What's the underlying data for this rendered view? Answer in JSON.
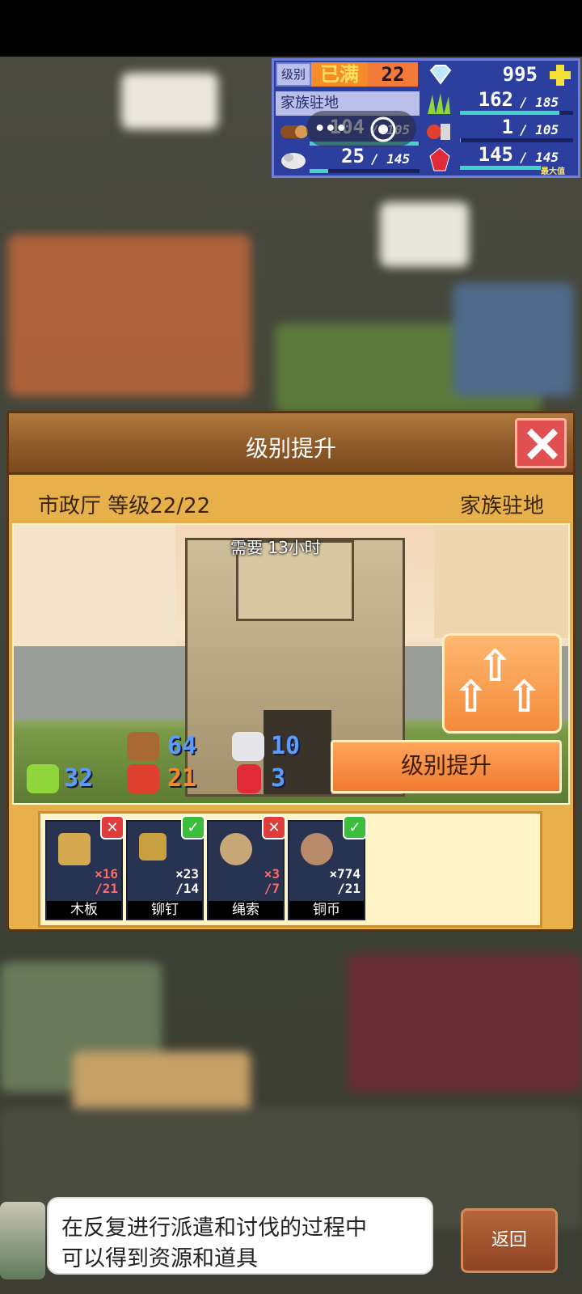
{
  "hud": {
    "level_label": "级别",
    "level_status": "已满",
    "level_value": "22",
    "gems": "995",
    "plus_icon": "plus-icon",
    "clan_name": "家族驻地",
    "wood": {
      "current": "104",
      "max": "105",
      "fill": 0.99
    },
    "ore": {
      "current": "25",
      "max": "145",
      "fill": 0.17
    },
    "grass": {
      "current": "162",
      "max": "185",
      "fill": 0.88
    },
    "food": {
      "current": "1",
      "max": "105",
      "fill": 0.01
    },
    "ruby": {
      "current": "145",
      "max": "145",
      "max_label": "最大值",
      "fill": 1.0
    }
  },
  "panel": {
    "title": "级别提升",
    "building": "市政厅 等级22/22",
    "location": "家族驻地",
    "need_time": "需要 13小时",
    "upgrade_button": "级别提升",
    "costs": {
      "wood": "64",
      "ore": "10",
      "grass": "32",
      "food": "21",
      "ruby": "3"
    },
    "items": [
      {
        "name": "木板",
        "have": "×16",
        "need": "/21",
        "ok": false,
        "badge": "✕"
      },
      {
        "name": "铆钉",
        "have": "×23",
        "need": "/14",
        "ok": true,
        "badge": "✓"
      },
      {
        "name": "绳索",
        "have": "×3",
        "need": "/7",
        "ok": false,
        "badge": "✕"
      },
      {
        "name": "铜币",
        "have": "×774",
        "need": "/21",
        "ok": true,
        "badge": "✓"
      }
    ]
  },
  "tip": {
    "line1": "在反复进行派遣和讨伐的过程中",
    "line2": "可以得到资源和道具"
  },
  "back_button": "返回",
  "colors": {
    "hud_bg": "#2d3f9e",
    "panel_bg": "#e8b04b",
    "accent_orange": "#f07a30",
    "close_red": "#e05050",
    "bar_teal": "#3fd6c8"
  }
}
